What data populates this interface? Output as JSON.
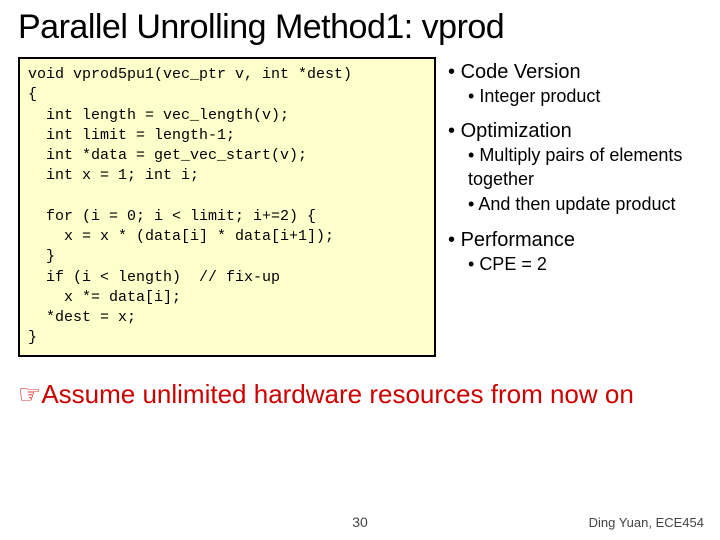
{
  "title": "Parallel Unrolling Method1: vprod",
  "code": "void vprod5pu1(vec_ptr v, int *dest)\n{\n  int length = vec_length(v);\n  int limit = length-1;\n  int *data = get_vec_start(v);\n  int x = 1; int i;\n\n  for (i = 0; i < limit; i+=2) {\n    x = x * (data[i] * data[i+1]);\n  }\n  if (i < length)  // fix-up\n    x *= data[i];\n  *dest = x;\n}",
  "bullets": [
    {
      "label": "Code Version",
      "children": [
        {
          "label": "Integer product"
        }
      ]
    },
    {
      "label": "Optimization",
      "children": [
        {
          "label": "Multiply pairs of elements together"
        },
        {
          "label": "And then update product"
        }
      ]
    },
    {
      "label": "Performance",
      "children": [
        {
          "label": "CPE = 2"
        }
      ]
    }
  ],
  "assume_text": "Assume unlimited hardware resources from now on",
  "page_number": "30",
  "footer": "Ding Yuan, ECE454"
}
